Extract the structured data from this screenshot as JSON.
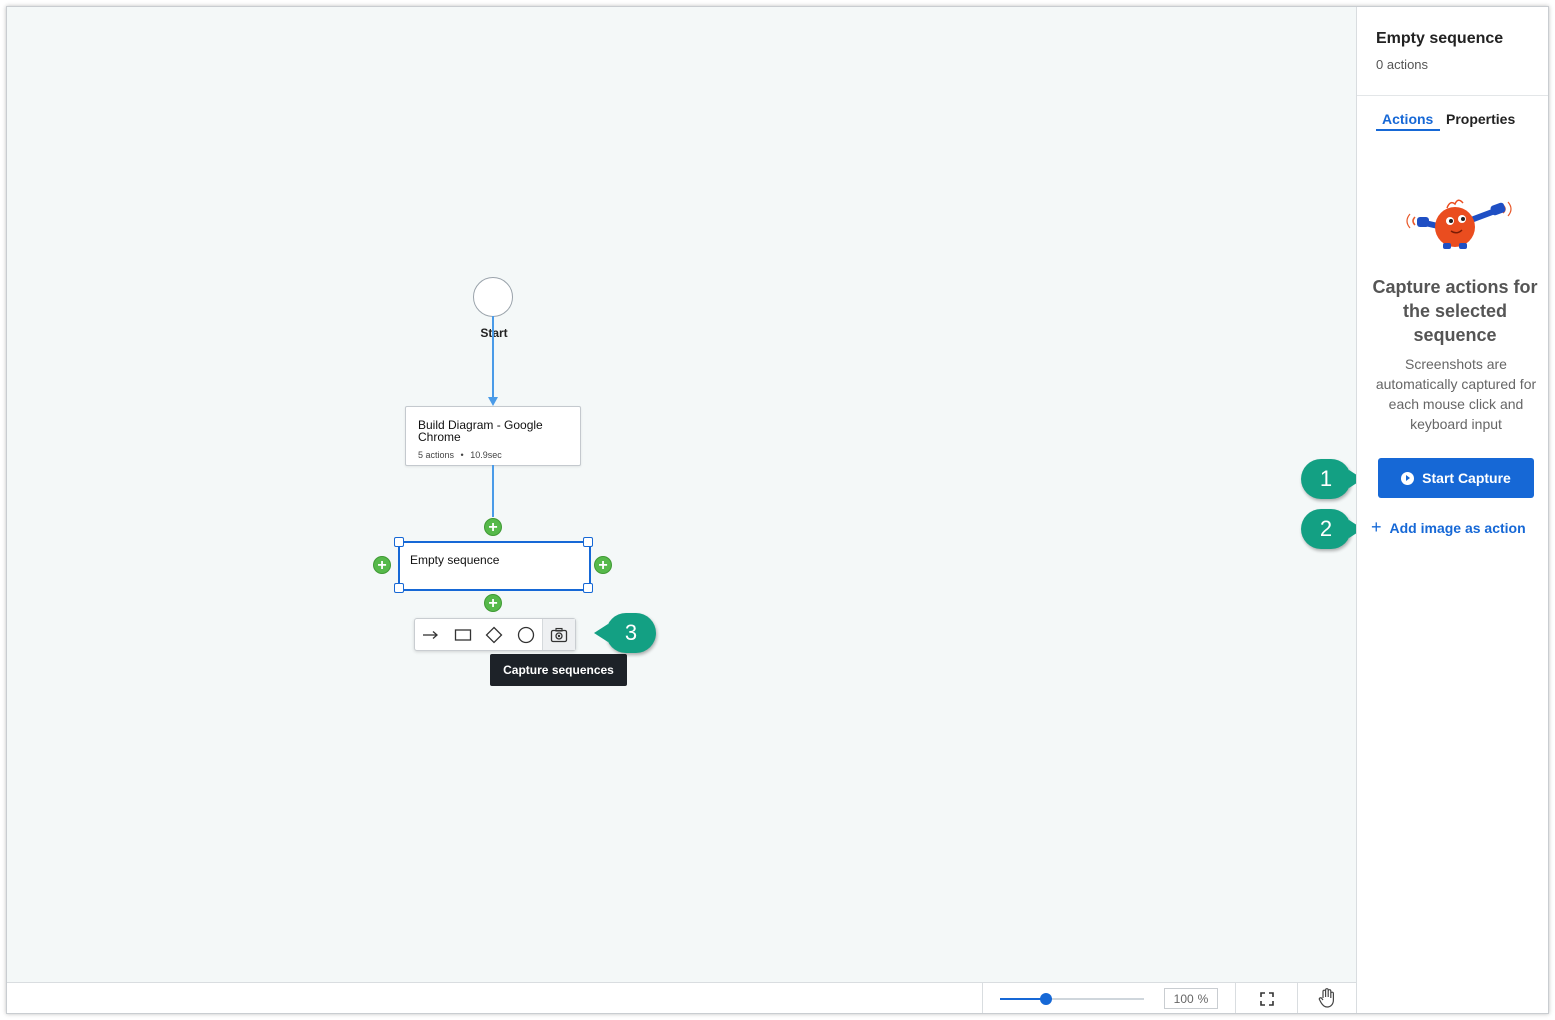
{
  "canvas": {
    "start_label": "Start",
    "sequence_card": {
      "title": "Build Diagram - Google Chrome",
      "actions": "5 actions",
      "separator": "•",
      "duration": "10.9sec"
    },
    "selected_card": {
      "title": "Empty sequence"
    },
    "add_symbol": "+",
    "toolbar": {
      "tools": [
        "arrow",
        "rectangle",
        "diamond",
        "circle",
        "capture"
      ],
      "tooltip": "Capture sequences"
    },
    "callouts": [
      "1",
      "2",
      "3"
    ]
  },
  "bottom_bar": {
    "zoom_value": "100",
    "zoom_unit": "%",
    "zoom_level": 0.32
  },
  "panel": {
    "title": "Empty sequence",
    "subtitle": "0 actions",
    "tabs": [
      "Actions",
      "Properties"
    ],
    "active_tab": "Actions",
    "empty_heading": "Capture actions for the selected sequence",
    "empty_text": "Screenshots are automatically captured for each mouse click and keyboard input",
    "start_capture": "Start Capture",
    "add_image": "Add image as action",
    "add_image_icon": "+"
  },
  "colors": {
    "accent": "#1668d6",
    "callout": "#13a083",
    "add_dot": "#56b94a",
    "connector": "#4a9be8"
  }
}
